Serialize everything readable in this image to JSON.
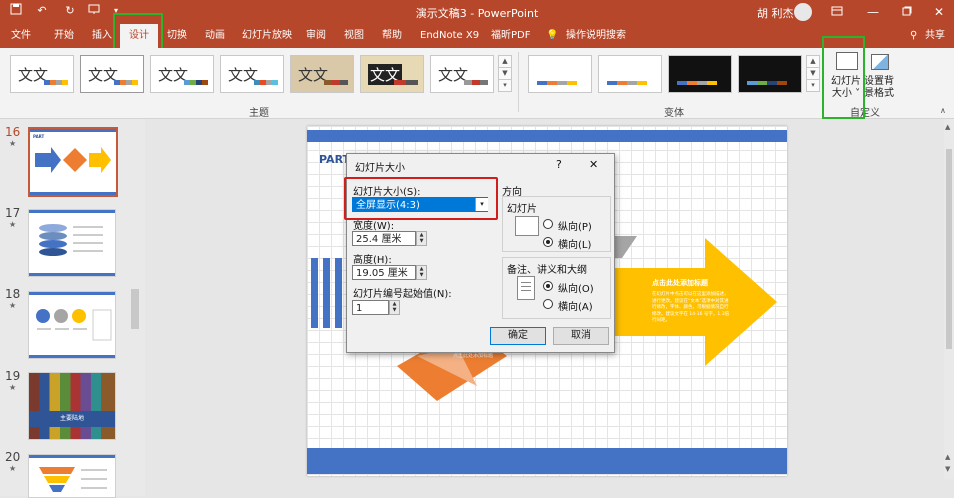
{
  "titlebar": {
    "doc_title": "演示文稿3 - PowerPoint",
    "user_name": "胡 利杰",
    "icons": [
      "save-icon",
      "undo-icon",
      "redo-icon",
      "present-icon",
      "customize-icon",
      "ribbon-display-icon",
      "minimize-icon",
      "maximize-icon",
      "close-icon"
    ]
  },
  "tabs": [
    {
      "label": "文件"
    },
    {
      "label": "开始"
    },
    {
      "label": "插入"
    },
    {
      "label": "设计",
      "active": true
    },
    {
      "label": "切换"
    },
    {
      "label": "动画"
    },
    {
      "label": "幻灯片放映"
    },
    {
      "label": "审阅"
    },
    {
      "label": "视图"
    },
    {
      "label": "帮助"
    },
    {
      "label": "EndNote X9"
    },
    {
      "label": "福昕PDF"
    },
    {
      "label": "操作说明搜索"
    }
  ],
  "share_label": "共享",
  "ribbon": {
    "themes": [
      "文文",
      "文文",
      "文文",
      "文文",
      "文文",
      "文文",
      "文文"
    ],
    "themes_group": "主题",
    "variants_group": "变体",
    "slide_size_label": [
      "幻灯片",
      "大小 ˅"
    ],
    "bg_format_label": [
      "设置背",
      "景格式"
    ],
    "customize_group": "自定义",
    "colors": {
      "accent": "#b7472a",
      "highlight_green": "#2db22d",
      "highlight_red": "#d21d1d"
    }
  },
  "thumbnails": [
    {
      "num": "16",
      "caption": "PART"
    },
    {
      "num": "17",
      "caption": ""
    },
    {
      "num": "18",
      "caption": ""
    },
    {
      "num": "19",
      "caption": "主要陆地"
    },
    {
      "num": "20",
      "caption": ""
    }
  ],
  "slide": {
    "part_label": "PART",
    "arrow_heading": "点击此处添加标题",
    "arrow_body": "在幻灯片中点击可以在这里添加描述，进行更改。建议在“文本”选项中对其进行修改，字体、颜色，可根据情况自行修改。建议文字在 14-16 号字，1.3倍行间距。",
    "small_text": "点击此处添加标题"
  },
  "dialog": {
    "title": "幻灯片大小",
    "help": "?",
    "close": "✕",
    "size_label": "幻灯片大小(S):",
    "size_value": "全屏显示(4:3)",
    "width_label": "宽度(W):",
    "width_value": "25.4 厘米",
    "height_label": "高度(H):",
    "height_value": "19.05 厘米",
    "start_label": "幻灯片编号起始值(N):",
    "start_value": "1",
    "orientation_label": "方向",
    "slides_label": "幻灯片",
    "portrait_label": "纵向(P)",
    "landscape_label": "横向(L)",
    "notes_label": "备注、讲义和大纲",
    "notes_portrait_label": "纵向(O)",
    "notes_landscape_label": "横向(A)",
    "ok": "确定",
    "cancel": "取消"
  }
}
